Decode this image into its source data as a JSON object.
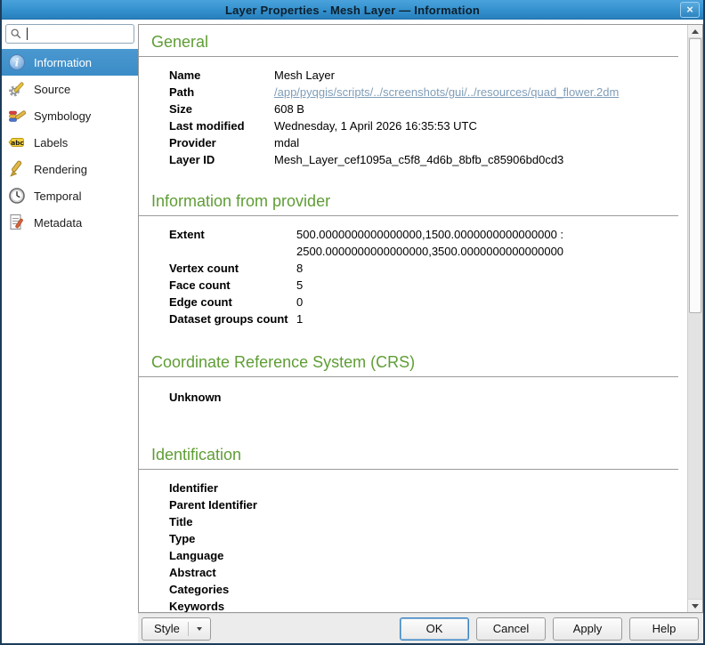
{
  "window": {
    "title": "Layer Properties - Mesh Layer — Information",
    "close_glyph": "×"
  },
  "sidebar": {
    "search_placeholder": "",
    "search_value": "",
    "items": [
      {
        "label": "Information",
        "selected": true
      },
      {
        "label": "Source",
        "selected": false
      },
      {
        "label": "Symbology",
        "selected": false
      },
      {
        "label": "Labels",
        "selected": false
      },
      {
        "label": "Rendering",
        "selected": false
      },
      {
        "label": "Temporal",
        "selected": false
      },
      {
        "label": "Metadata",
        "selected": false
      }
    ]
  },
  "content": {
    "general": {
      "heading": "General",
      "rows": [
        {
          "label": "Name",
          "value": "Mesh Layer"
        },
        {
          "label": "Path",
          "value": "/app/pyqgis/scripts/../screenshots/gui/../resources/quad_flower.2dm"
        },
        {
          "label": "Size",
          "value": "608 B"
        },
        {
          "label": "Last modified",
          "value": "Wednesday, 1 April 2026 16:35:53 UTC"
        },
        {
          "label": "Provider",
          "value": "mdal"
        },
        {
          "label": "Layer ID",
          "value": "Mesh_Layer_cef1095a_c5f8_4d6b_8bfb_c85906bd0cd3"
        }
      ]
    },
    "provider_info": {
      "heading": "Information from provider",
      "rows": [
        {
          "label": "Extent",
          "value": "500.0000000000000000,1500.0000000000000000 : 2500.0000000000000000,3500.0000000000000000"
        },
        {
          "label": "Vertex count",
          "value": "8"
        },
        {
          "label": "Face count",
          "value": "5"
        },
        {
          "label": "Edge count",
          "value": "0"
        },
        {
          "label": "Dataset groups count",
          "value": "1"
        }
      ]
    },
    "crs": {
      "heading": "Coordinate Reference System (CRS)",
      "value": "Unknown"
    },
    "identification": {
      "heading": "Identification",
      "labels": [
        "Identifier",
        "Parent Identifier",
        "Title",
        "Type",
        "Language",
        "Abstract",
        "Categories",
        "Keywords"
      ]
    }
  },
  "footer": {
    "style_button": "Style",
    "ok": "OK",
    "cancel": "Cancel",
    "apply": "Apply",
    "help": "Help"
  },
  "colors": {
    "titlebar_top": "#4aa2dc",
    "titlebar_bottom": "#2980bd",
    "selection": "#3b8cc7",
    "heading_green": "#5f9d35",
    "link": "#7f9db8"
  }
}
